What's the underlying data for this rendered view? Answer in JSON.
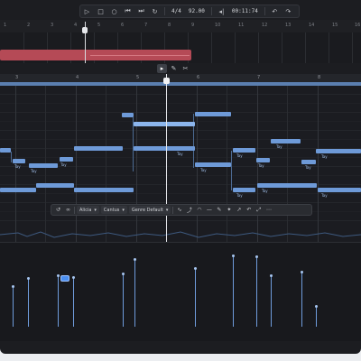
{
  "transport": {
    "time_signature": "4/4",
    "tempo": "92.00",
    "position": "00:11:74",
    "icons": [
      "play-icon",
      "stop-icon",
      "record-icon",
      "skip-back-icon",
      "skip-forward-icon",
      "loop-icon",
      "metronome-icon",
      "undo-icon",
      "redo-icon"
    ]
  },
  "arrangement": {
    "bar_numbers": [
      "1",
      "2",
      "3",
      "4",
      "5",
      "6",
      "7",
      "8",
      "9",
      "10",
      "11",
      "12",
      "13",
      "14",
      "15",
      "16"
    ],
    "clip_color": "#b54a56"
  },
  "editor_tools": {
    "icons": [
      "pointer-icon",
      "pencil-icon",
      "scissors-icon"
    ]
  },
  "piano_roll": {
    "bar_numbers": [
      "3",
      "4",
      "5",
      "6",
      "7",
      "8"
    ],
    "note_labels": [
      "Tay",
      "Tay",
      "Tay",
      "Tay",
      "Tay",
      "Tay",
      "Tay",
      "Tay",
      "Tay",
      "Tay",
      "Tay",
      "Tay",
      "Tay"
    ],
    "accent_color": "#6e9ad8"
  },
  "float_toolbar": {
    "select_1": "Alicia",
    "select_2": "Cantus",
    "select_3": "Genre Default"
  },
  "velocity": {
    "accent_color": "#6f9cdc"
  }
}
